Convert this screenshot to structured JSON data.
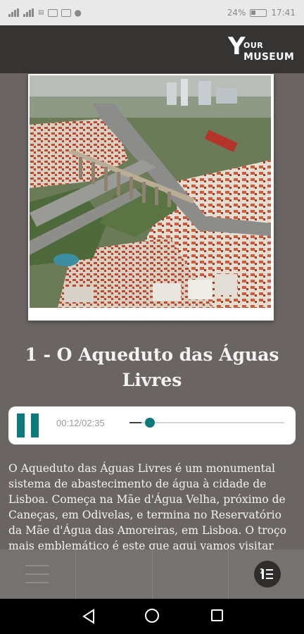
{
  "status_bar": {
    "left_icons": [
      "signal-icon",
      "signal-icon",
      "data-icon",
      "gallery-icon",
      "email-icon",
      "messenger-icon"
    ],
    "battery": "24%",
    "time": "17:41"
  },
  "header": {
    "logo": {
      "big_letter": "Y",
      "line1": "OUR",
      "line2": "MUSEUM"
    }
  },
  "photo": {
    "subject": "aerial-view-aqueduct"
  },
  "title": "1 - O Aqueduto das Águas Livres",
  "player": {
    "state": "playing",
    "time_label": "00:12/02:35",
    "progress": 0.077,
    "accent_color": "#0c7a7a"
  },
  "description": "O Aqueduto das Águas Livres é um monumental sistema de abastecimento de água à cidade de Lisboa. Começa na Mãe d'Água Velha, próximo de Caneças, em Odivelas, e termina no Reservatório da Mãe d'Água das Amoreiras, em Lisboa. O troço mais emblemático é este que aqui vamos visitar",
  "toolbar": {
    "items": [
      "menu-icon",
      "",
      "",
      "list-icon"
    ],
    "list_badge": "1"
  },
  "nav_bar": {
    "buttons": [
      "back-icon",
      "home-icon",
      "recents-icon"
    ]
  }
}
